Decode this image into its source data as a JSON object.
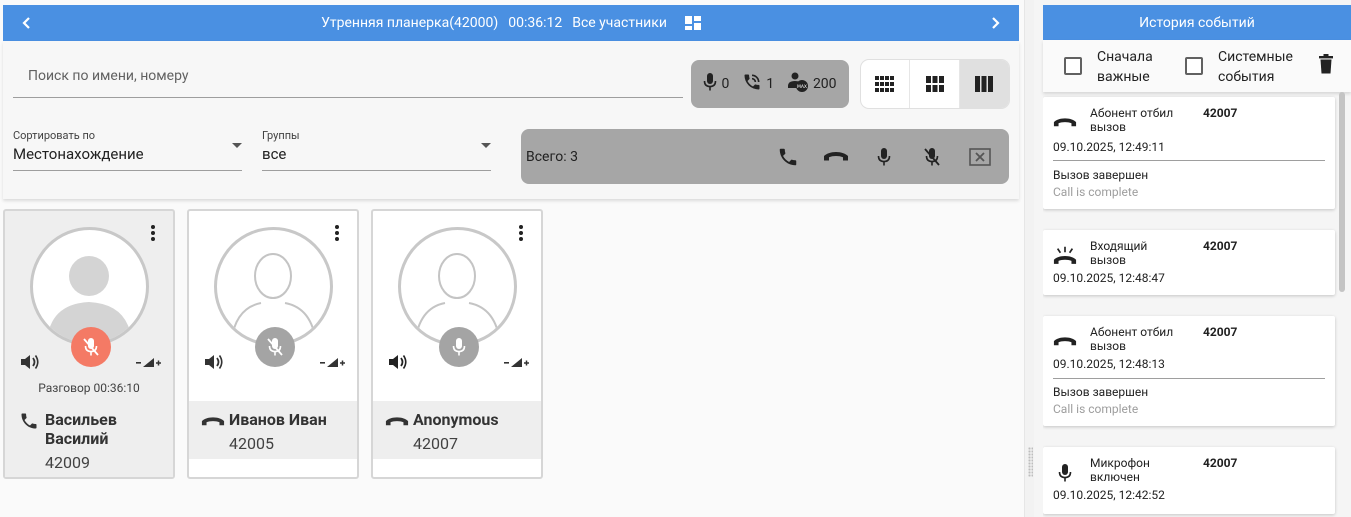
{
  "header": {
    "conference": "Утренняя планерка(42000)",
    "timer": "00:36:12",
    "participants_label": "Все участники"
  },
  "search": {
    "placeholder": "Поиск по имени, номеру"
  },
  "stats": {
    "mic_count": "0",
    "calls_count": "1",
    "max_count": "200"
  },
  "sort": {
    "label": "Сортировать по",
    "value": "Местонахождение"
  },
  "groups": {
    "label": "Группы",
    "value": "все"
  },
  "actions": {
    "total": "Всего: 3"
  },
  "participants": [
    {
      "name_line1": "Васильев",
      "name_line2": "Василий",
      "number": "42009",
      "duration": "Разговор 00:36:10"
    },
    {
      "name_line1": "Иванов Иван",
      "number": "42005"
    },
    {
      "name_line1": "Anonymous",
      "number": "42007"
    }
  ],
  "events_panel": {
    "title": "История событий",
    "important_first_line1": "Сначала",
    "important_first_line2": "важные",
    "system_events_line1": "Системные",
    "system_events_line2": "события"
  },
  "events": [
    {
      "title_line1": "Абонент отбил",
      "title_line2": "вызов",
      "number": "42007",
      "datetime": "09.10.2025, 12:49:11",
      "status": "Вызов завершен",
      "status_sub": "Call is complete"
    },
    {
      "title_line1": "Входящий",
      "title_line2": "вызов",
      "number": "42007",
      "datetime": "09.10.2025, 12:48:47"
    },
    {
      "title_line1": "Абонент отбил",
      "title_line2": "вызов",
      "number": "42007",
      "datetime": "09.10.2025, 12:48:13",
      "status": "Вызов завершен",
      "status_sub": "Call is complete"
    },
    {
      "title_line1": "Микрофон",
      "title_line2": "включен",
      "number": "42007",
      "datetime": "09.10.2025, 12:42:52"
    }
  ],
  "colors": {
    "accent": "#4a90e2",
    "muted_red": "#f47a65",
    "panel_grey": "#a6a6a6"
  }
}
